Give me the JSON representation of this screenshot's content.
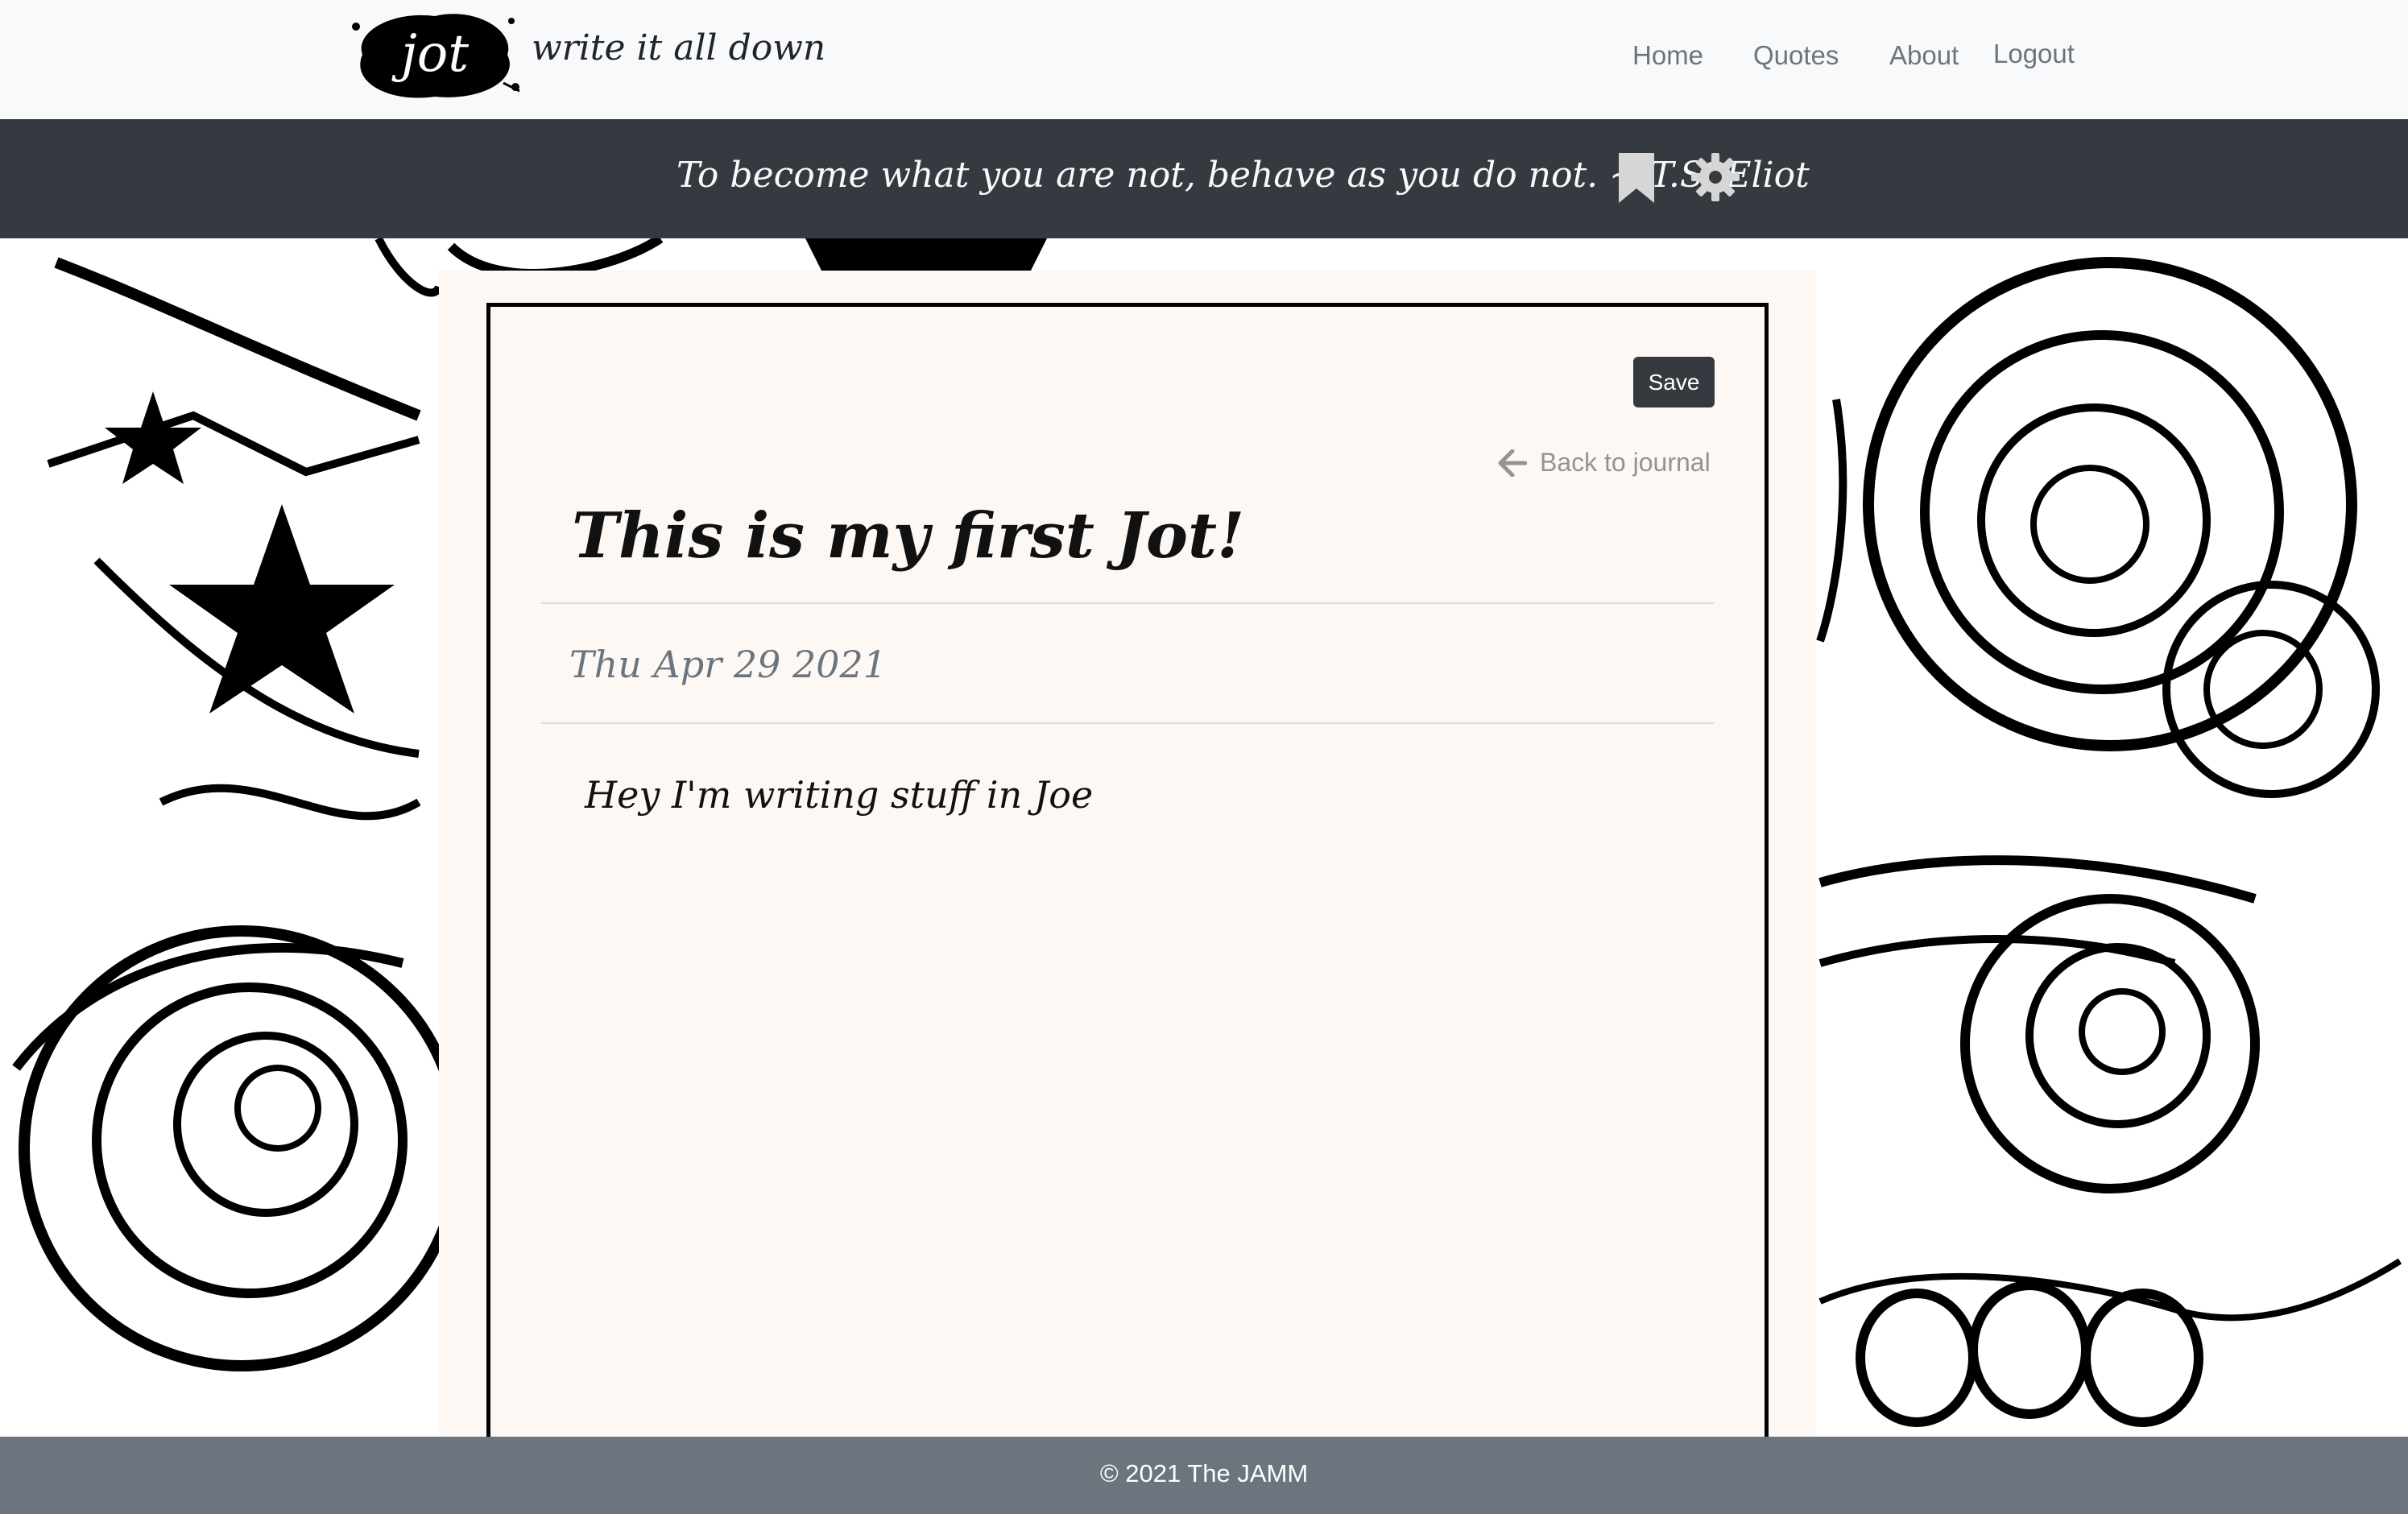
{
  "header": {
    "logo_text": "jot",
    "tagline": "write it all down",
    "nav": {
      "home": "Home",
      "quotes": "Quotes",
      "about": "About",
      "logout": "Logout"
    }
  },
  "quote_bar": {
    "quote": "To become what you are not, behave as you do not. ~ T.S. Eliot",
    "bookmark_icon": "bookmark-icon",
    "settings_icon": "gear-icon"
  },
  "entry": {
    "save_label": "Save",
    "back_label": "Back to journal",
    "back_icon": "arrow-left-icon",
    "title": "This is my first Jot!",
    "date": "Thu Apr 29 2021",
    "body": "Hey I'm writing stuff in Joe"
  },
  "footer": {
    "copyright": "© 2021 The JAMM"
  },
  "colors": {
    "navbar_bg": "#f8f9fa",
    "quotebar_bg": "#343a40",
    "paper_bg": "#fdf8f4",
    "footer_bg": "#6c757d",
    "button_bg": "#343a40"
  }
}
